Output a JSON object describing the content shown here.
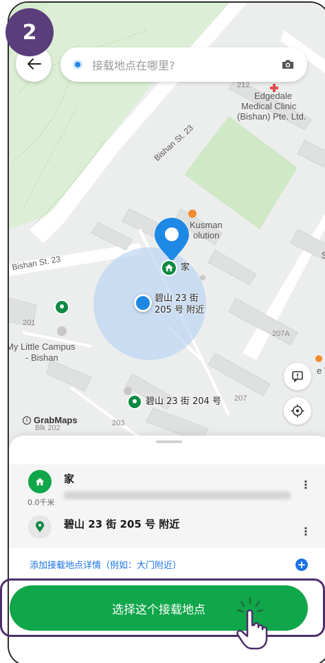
{
  "step": {
    "number": "2"
  },
  "search": {
    "placeholder": "接载地点在哪里?"
  },
  "map": {
    "labels": {
      "medical": [
        "Edgedale",
        "Medical Clinic",
        "(Bishan) Pte. Ltd."
      ],
      "kusman": [
        "Kusman",
        "olution"
      ],
      "campus": [
        "My Little Campus",
        "- Bishan"
      ],
      "edge_right": "Sh",
      "edge_tr": "e Tr"
    },
    "roads": {
      "bishan_23_a": "Bishan St. 23",
      "bishan_23_b": "Bishan St. 23"
    },
    "numbers": {
      "n212": "212",
      "n201": "201",
      "n207a": "207A",
      "n207": "207",
      "n203": "203",
      "blk202": "Blk 202"
    },
    "pins": {
      "home": "家",
      "current": [
        "碧山 23 街",
        "205 号 附近"
      ],
      "block204": "碧山 23 街 204 号"
    },
    "brand": "GrabMaps",
    "colors": {
      "accent_green": "#10a64a",
      "pin_blue": "#1e88e5",
      "park_green": "#cfe8c6",
      "badge_purple": "#5b3d7c"
    }
  },
  "sheet": {
    "results": [
      {
        "icon": "home-icon",
        "title": "家",
        "distance": "0.0千米"
      },
      {
        "icon": "location-pin-icon",
        "title": "碧山 23 街 205 号 附近"
      }
    ],
    "details_link": "添加接载地点详情（例如：大门附近）",
    "confirm_button": "选择这个接载地点"
  }
}
